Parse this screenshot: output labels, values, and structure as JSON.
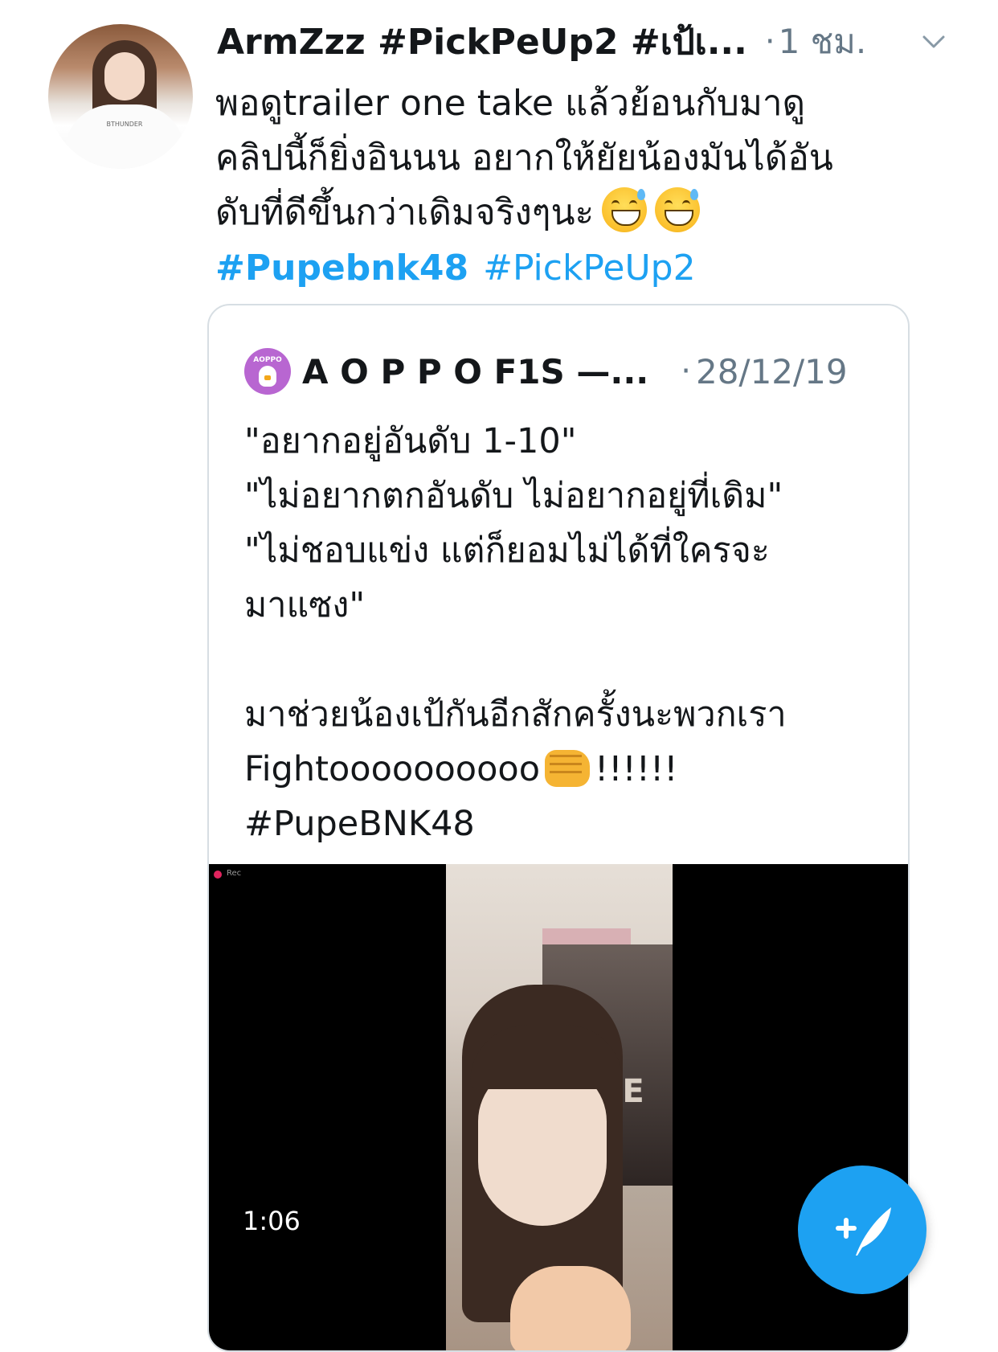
{
  "tweet": {
    "display_name": "ArmZzz #PickPeUp2 #เป้เ...",
    "timestamp": "1 ชม.",
    "text_lines": [
      "พอดูtrailer one take แล้วย้อนกับมาดู",
      "คลิปนี้ก็ยิ่งอินนน อยากให้ยัยน้องมันได้อัน",
      "ดับที่ดีขึ้นกว่าเดิมจริงๆนะ"
    ],
    "emojis": [
      "grinning-sweat-emoji",
      "grinning-sweat-emoji"
    ],
    "hashtags": [
      {
        "label": "#Pupebnk48",
        "bold": true
      },
      {
        "label": "#PickPeUp2",
        "bold": false
      }
    ],
    "menu_icon": "chevron-down-icon",
    "avatar_text": "BTHUNDER"
  },
  "quoted_tweet": {
    "avatar_label": "AOPPO",
    "display_name": "A O P P O F1S —...",
    "timestamp": "28/12/19",
    "text_lines": [
      "\"อยากอยู่อันดับ 1-10\"",
      "\"ไม่อยากตกอันดับ ไม่อยากอยู่ที่เดิม\"",
      "\"ไม่ชอบแข่ง แต่ก็ยอมไม่ได้ที่ใครจะ",
      "มาแซง\"",
      "",
      "มาช่วยน้องเป้กันอีกสักครั้งนะพวกเรา"
    ],
    "fight_text": "Fightoooooooooo",
    "fight_suffix": "!!!!!!",
    "hashtag_line": "#PupeBNK48",
    "media": {
      "type": "video",
      "duration": "1:06",
      "rec_label": "Rec",
      "poster_text": "PE"
    }
  },
  "compose_button": {
    "icon": "compose-feather-icon",
    "color": "#1da1f2"
  },
  "colors": {
    "accent": "#1da1f2",
    "secondary_text": "#657786",
    "primary_text": "#14171a",
    "border": "#d7dee3"
  }
}
